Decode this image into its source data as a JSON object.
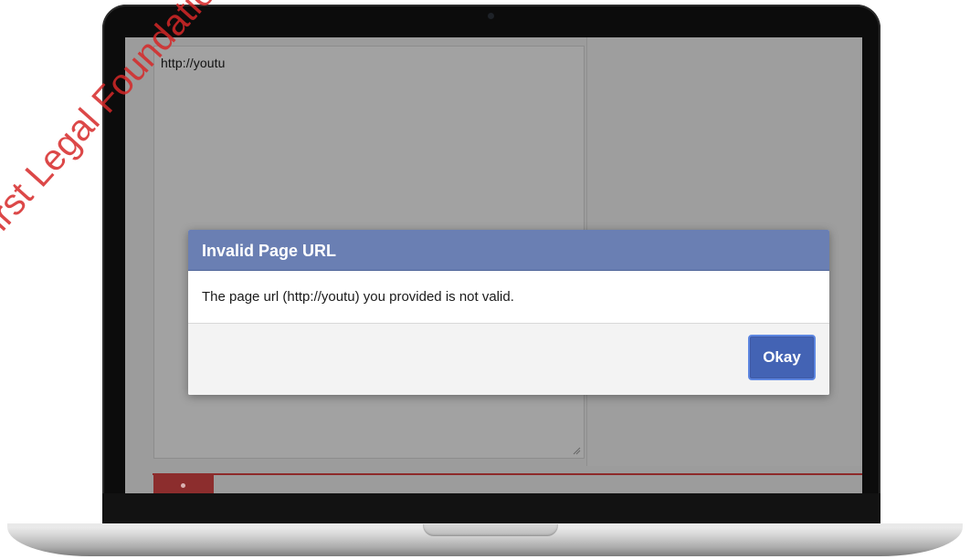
{
  "textarea": {
    "value": "http://youtu"
  },
  "dialog": {
    "title": "Invalid Page URL",
    "message": "The page url (http://youtu) you provided is not valid.",
    "okay_label": "Okay"
  },
  "watermark": {
    "text": "First Legal Foundation"
  },
  "colors": {
    "dialog_header": "#6a7fb3",
    "okay_button": "#4363b4",
    "red_accent": "#8c2d2d"
  }
}
